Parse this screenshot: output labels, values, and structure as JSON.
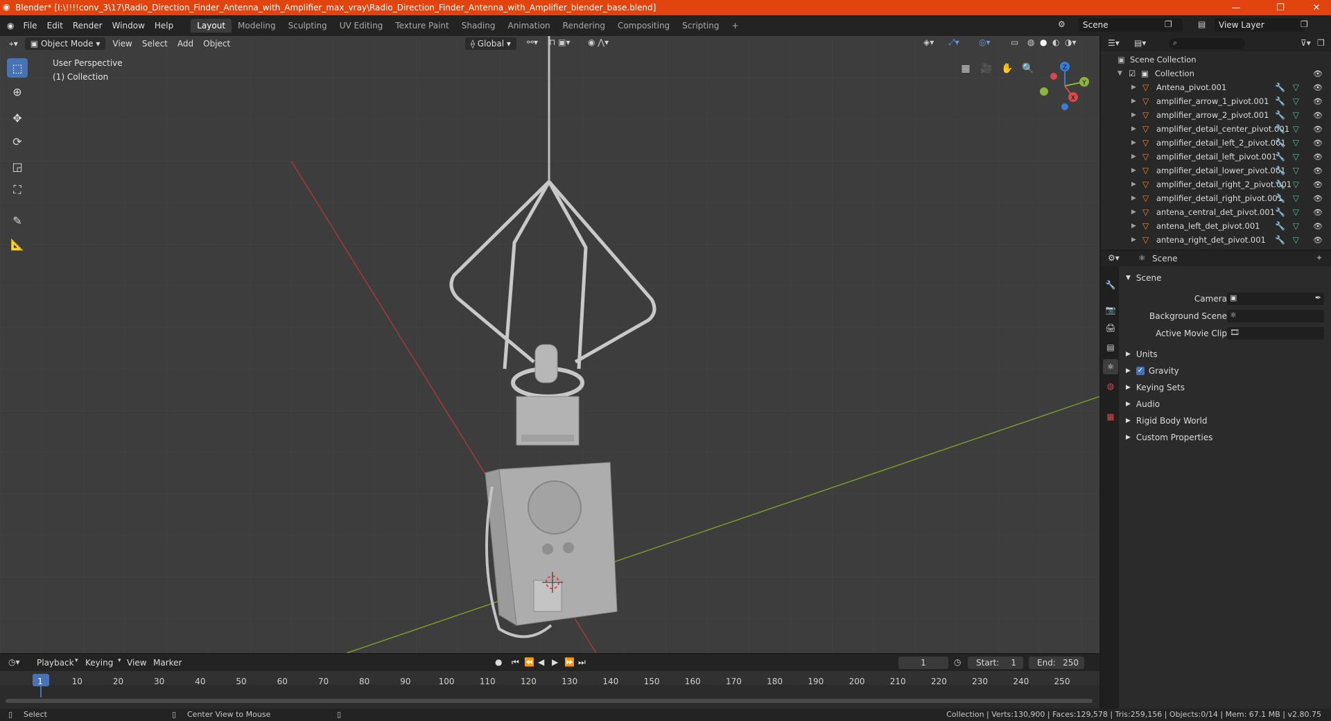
{
  "window": {
    "title": "Blender* [I:\\!!!!conv_3\\17\\Radio_Direction_Finder_Antenna_with_Amplifier_max_vray\\Radio_Direction_Finder_Antenna_with_Amplifier_blender_base.blend]",
    "minimize": "—",
    "maximize": "❐",
    "close": "✕"
  },
  "menu": [
    "File",
    "Edit",
    "Render",
    "Window",
    "Help"
  ],
  "workspaces": [
    "Layout",
    "Modeling",
    "Sculpting",
    "UV Editing",
    "Texture Paint",
    "Shading",
    "Animation",
    "Rendering",
    "Compositing",
    "Scripting"
  ],
  "active_workspace": "Layout",
  "add_workspace": "+",
  "scene_field": "Scene",
  "view_layer_field": "View Layer",
  "viewport": {
    "mode": "Object Mode",
    "menus": [
      "View",
      "Select",
      "Add",
      "Object"
    ],
    "orientation": "Global",
    "overlay_line1": "User Perspective",
    "overlay_line2": "(1) Collection",
    "gizmo": {
      "z": "Z",
      "y": "Y",
      "x": "X"
    }
  },
  "outliner": {
    "root": "Scene Collection",
    "collection": "Collection",
    "items": [
      "Antena_pivot.001",
      "amplifier_arrow_1_pivot.001",
      "amplifier_arrow_2_pivot.001",
      "amplifier_detail_center_pivot.001",
      "amplifier_detail_left_2_pivot.001",
      "amplifier_detail_left_pivot.001",
      "amplifier_detail_lower_pivot.001",
      "amplifier_detail_right_2_pivot.001",
      "amplifier_detail_right_pivot.001",
      "antena_central_det_pivot.001",
      "antena_left_det_pivot.001",
      "antena_right_det_pivot.001"
    ]
  },
  "properties": {
    "breadcrumb": "Scene",
    "panel": "Scene",
    "fields": [
      {
        "label": "Camera"
      },
      {
        "label": "Background Scene"
      },
      {
        "label": "Active Movie Clip"
      }
    ],
    "sections": [
      "Units",
      "Gravity",
      "Keying Sets",
      "Audio",
      "Rigid Body World",
      "Custom Properties"
    ],
    "gravity_checked": true
  },
  "timeline": {
    "menus": [
      "Playback",
      "Keying",
      "View",
      "Marker"
    ],
    "current_frame": "1",
    "start_label": "Start:",
    "start": "1",
    "end_label": "End:",
    "end": "250",
    "ticks": [
      "1",
      "10",
      "20",
      "30",
      "40",
      "50",
      "60",
      "70",
      "80",
      "90",
      "100",
      "110",
      "120",
      "130",
      "140",
      "150",
      "160",
      "170",
      "180",
      "190",
      "200",
      "210",
      "220",
      "230",
      "240",
      "250"
    ]
  },
  "status": {
    "left1": "Select",
    "left2": "Center View to Mouse",
    "right": "Collection | Verts:130,900 | Faces:129,578 | Tris:259,156 | Objects:0/14 | Mem: 67.1 MB | v2.80.75"
  },
  "colors": {
    "accent": "#4772b3",
    "titlebar": "#e2440f",
    "mesh_icon": "#e98b32",
    "modifier_icon": "#7aa7e8",
    "data_icon": "#52c08a"
  }
}
